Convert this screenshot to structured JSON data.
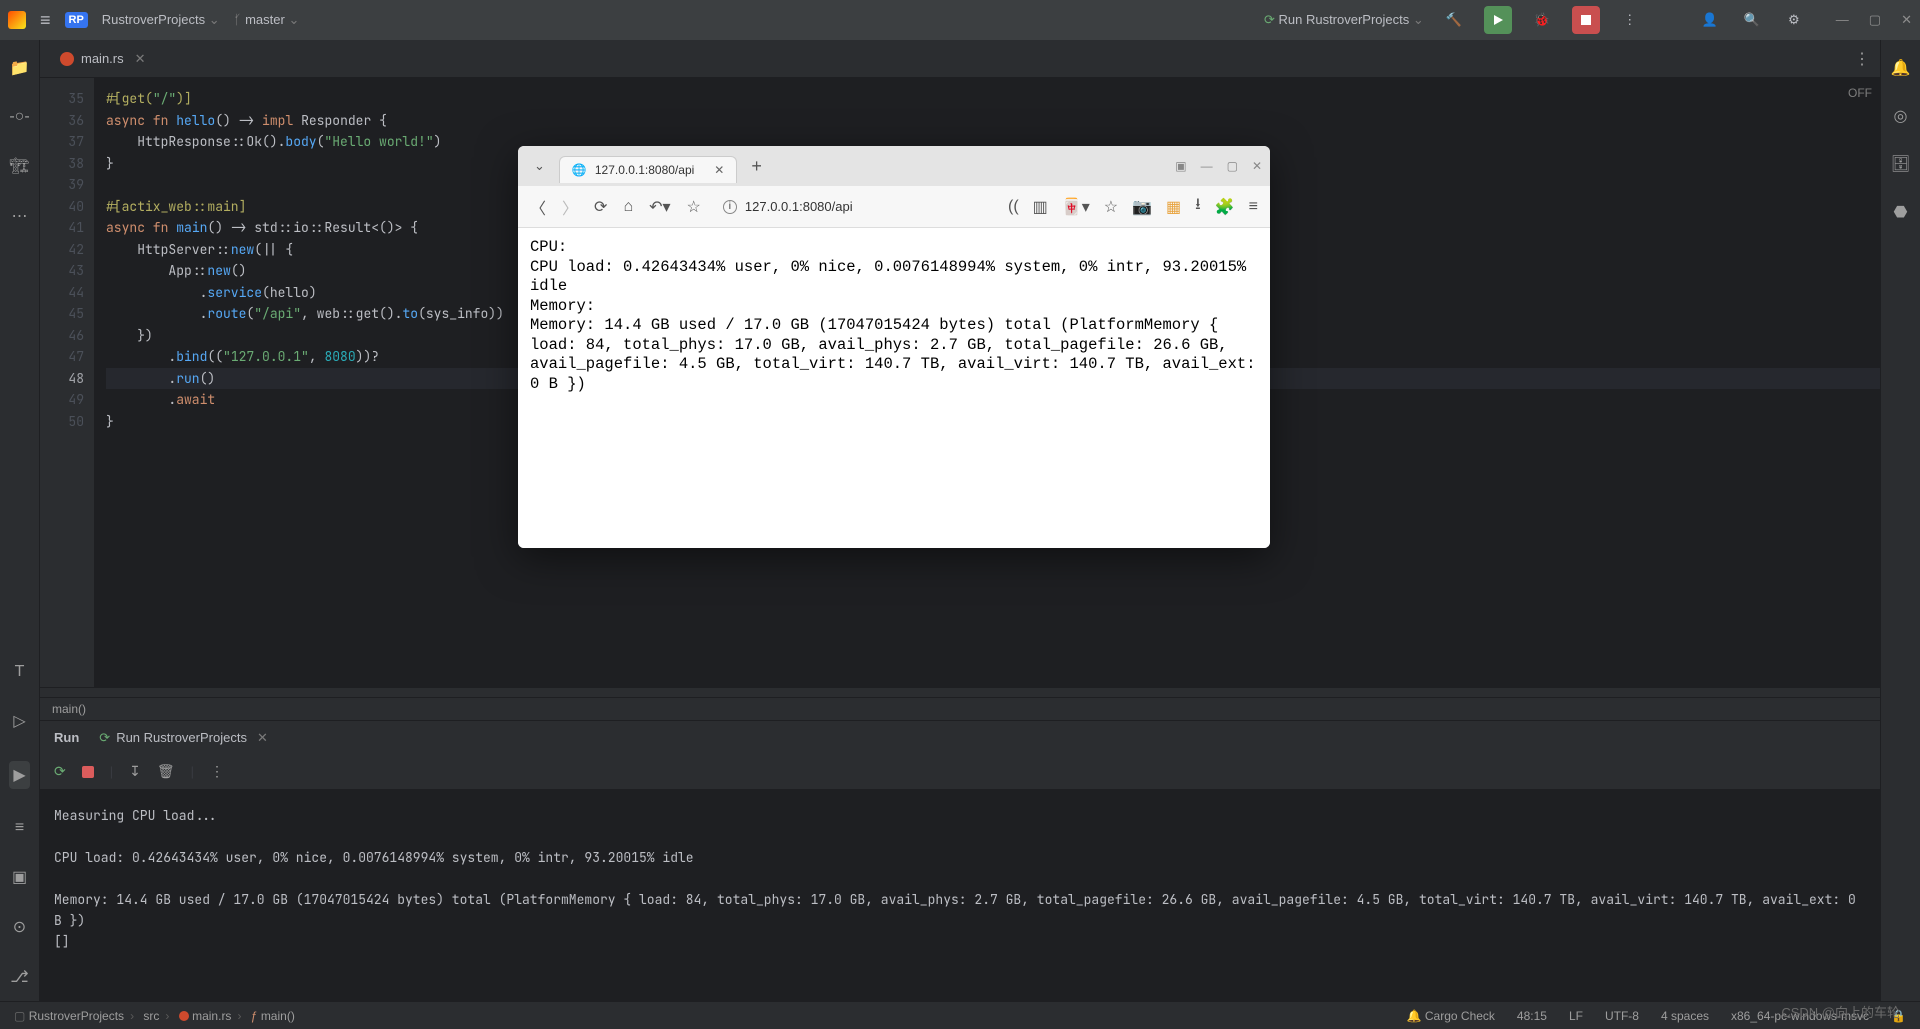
{
  "titlebar": {
    "project": "RustroverProjects",
    "branch": "master",
    "run_config": "Run RustroverProjects"
  },
  "file_tab": {
    "name": "main.rs"
  },
  "off_label": "OFF",
  "gutter_start": 35,
  "cursor_line": 48,
  "code_lines": [
    {
      "n": 35,
      "html": "<span class='attr'>#[get(</span><span class='st'>\"/\"</span><span class='attr'>)]</span>"
    },
    {
      "n": 36,
      "html": "<span class='kw'>async fn</span> <span class='fn'>hello</span>() -&gt; <span class='kw'>impl</span> <span class='ty'>Responder</span> {"
    },
    {
      "n": 37,
      "html": "    HttpResponse::Ok().<span class='fn'>body</span>(<span class='st'>\"Hello world!\"</span>)"
    },
    {
      "n": 38,
      "html": "}"
    },
    {
      "n": 39,
      "html": ""
    },
    {
      "n": 40,
      "html": "<span class='attr'>#[actix_web::main]</span>"
    },
    {
      "n": 41,
      "html": "<span class='kw'>async fn</span> <span class='fn'>main</span>() -&gt; std::io::Result&lt;()&gt; {"
    },
    {
      "n": 42,
      "html": "    HttpServer::<span class='fn'>new</span>(|| {"
    },
    {
      "n": 43,
      "html": "        App::<span class='fn'>new</span>()"
    },
    {
      "n": 44,
      "html": "            .<span class='fn'>service</span>(hello)"
    },
    {
      "n": 45,
      "html": "            .<span class='fn'>route</span>(<span class='st'>\"/api\"</span>, web::get().<span class='fn'>to</span>(sys_info))"
    },
    {
      "n": 46,
      "html": "    })"
    },
    {
      "n": 47,
      "html": "        .<span class='fn'>bind</span>((<span class='st'>\"127.0.0.1\"</span>, <span class='num'>8080</span>))?"
    },
    {
      "n": 48,
      "html": "        .<span class='fn'>run</span>()"
    },
    {
      "n": 49,
      "html": "        .<span class='kw'>await</span>"
    },
    {
      "n": 50,
      "html": "}"
    }
  ],
  "crumb": "main()",
  "run_tabs": {
    "active": "Run",
    "second": "Run RustroverProjects"
  },
  "console": "Measuring CPU load...\n\nCPU load: 0.42643434% user, 0% nice, 0.0076148994% system, 0% intr, 93.20015% idle\n\nMemory: 14.4 GB used / 17.0 GB (17047015424 bytes) total (PlatformMemory { load: 84, total_phys: 17.0 GB, avail_phys: 2.7 GB, total_pagefile: 26.6 GB, avail_pagefile: 4.5 GB, total_virt: 140.7 TB, avail_virt: 140.7 TB, avail_ext: 0 B })\n[]",
  "status": {
    "breadcrumbs": [
      "RustroverProjects",
      "src",
      "main.rs",
      "main()"
    ],
    "cargo": "Cargo Check",
    "pos": "48:15",
    "lf": "LF",
    "enc": "UTF-8",
    "indent": "4 spaces",
    "target": "x86_64-pc-windows-msvc"
  },
  "browser": {
    "tab_title": "127.0.0.1:8080/api",
    "url": "127.0.0.1:8080/api",
    "body": "CPU:\nCPU load: 0.42643434% user, 0% nice, 0.0076148994% system, 0% intr, 93.20015% idle\nMemory:\nMemory: 14.4 GB used / 17.0 GB (17047015424 bytes) total (PlatformMemory { load: 84, total_phys: 17.0 GB, avail_phys: 2.7 GB, total_pagefile: 26.6 GB, avail_pagefile: 4.5 GB, total_virt: 140.7 TB, avail_virt: 140.7 TB, avail_ext: 0 B })"
  },
  "watermark": "CSDN @向上的车轮"
}
